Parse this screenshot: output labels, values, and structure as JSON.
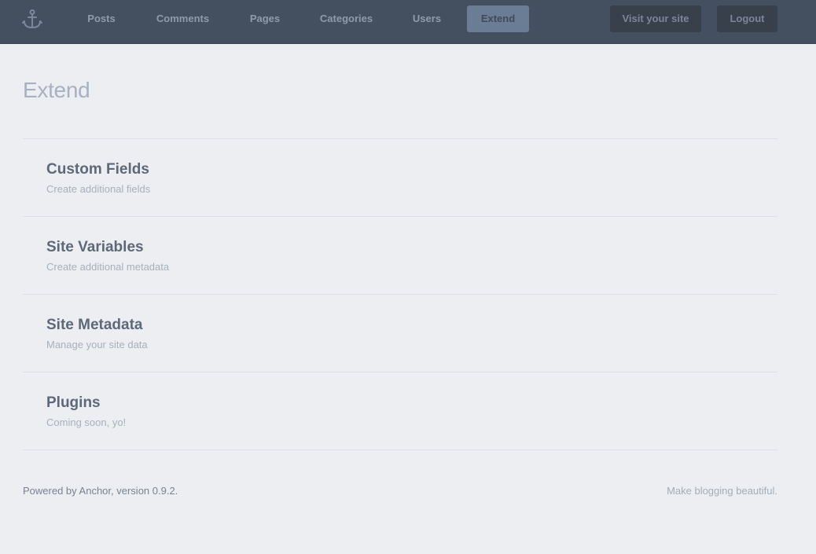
{
  "nav": {
    "items": [
      {
        "label": "Posts"
      },
      {
        "label": "Comments"
      },
      {
        "label": "Pages"
      },
      {
        "label": "Categories"
      },
      {
        "label": "Users"
      },
      {
        "label": "Extend",
        "active": true
      }
    ],
    "visit_label": "Visit your site",
    "logout_label": "Logout"
  },
  "page": {
    "title": "Extend"
  },
  "extend_items": [
    {
      "title": "Custom Fields",
      "description": "Create additional fields"
    },
    {
      "title": "Site Variables",
      "description": "Create additional metadata"
    },
    {
      "title": "Site Metadata",
      "description": "Manage your site data"
    },
    {
      "title": "Plugins",
      "description": "Coming soon, yo!"
    }
  ],
  "footer": {
    "powered_by": "Powered by Anchor, version 0.9.2.",
    "tagline": "Make blogging beautiful."
  },
  "colors": {
    "topbar": "#444f5f",
    "active_tab": "#6b7c95",
    "background": "#eceef2"
  }
}
